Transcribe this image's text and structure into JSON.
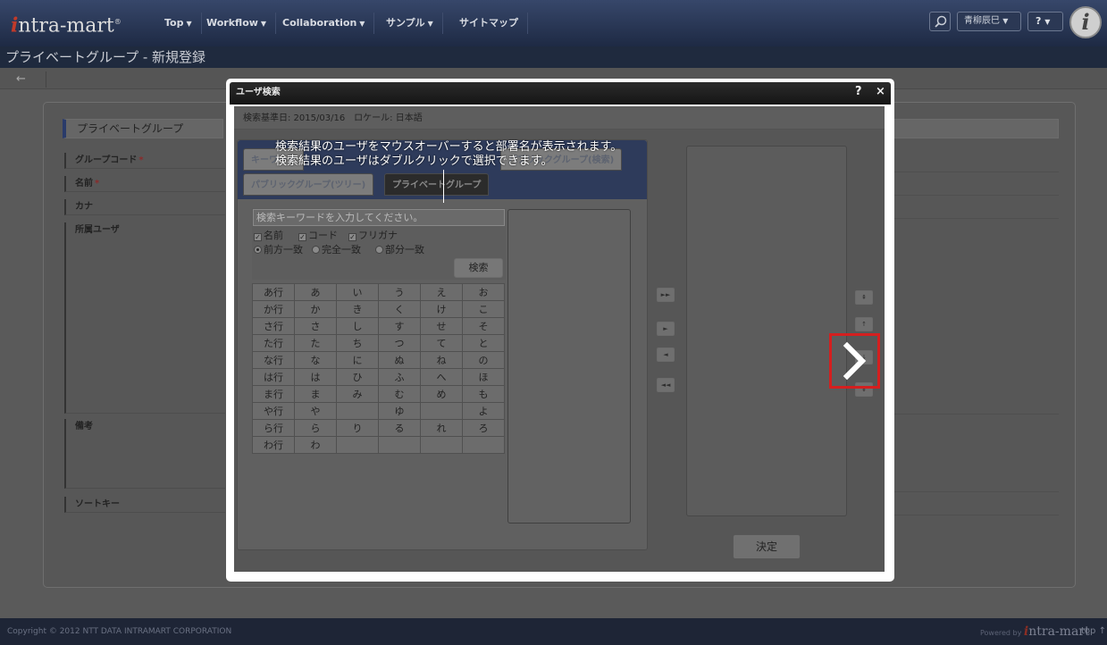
{
  "navbar": {
    "logo_prefix": "i",
    "logo_rest": "ntra-mart",
    "logo_mark": "®",
    "menus": [
      {
        "label": "Top"
      },
      {
        "label": "Workflow"
      },
      {
        "label": "Collaboration"
      },
      {
        "label": "サンプル"
      },
      {
        "label": "サイトマップ"
      }
    ],
    "search_icon": "search-icon",
    "user_name": "青柳辰巳",
    "help_label": "?"
  },
  "page": {
    "title": "プライベートグループ - 新規登録",
    "back_icon": "←"
  },
  "form": {
    "section_title": "プライベートグループ",
    "fields": [
      {
        "label": "グループコード",
        "required": "*"
      },
      {
        "label": "名前",
        "required": "*"
      },
      {
        "label": "カナ",
        "required": ""
      },
      {
        "label": "所属ユーザ",
        "required": ""
      },
      {
        "label": "備考",
        "required": ""
      },
      {
        "label": "ソートキー",
        "required": ""
      }
    ]
  },
  "modal": {
    "title": "ユーザ検索",
    "help": "?",
    "close": "×",
    "basis": "検索基準日: 2015/03/16　ロケール: 日本語",
    "tabs": [
      {
        "label": "キーワード"
      },
      {
        "label": "パブリックグループ(検索)"
      },
      {
        "label": "パブリックグループ(ツリー)"
      },
      {
        "label": "プライベートグループ"
      }
    ],
    "tip_lines": [
      "検索結果のユーザをマウスオーバーすると部署名が表示されます。",
      "検索結果のユーザはダブルクリックで選択できます。"
    ],
    "search_placeholder": "検索キーワードを入力してください。",
    "checkboxes": [
      {
        "label": "名前",
        "checked": true
      },
      {
        "label": "コード",
        "checked": true
      },
      {
        "label": "フリガナ",
        "checked": true
      }
    ],
    "radios": [
      {
        "label": "前方一致",
        "selected": true
      },
      {
        "label": "完全一致",
        "selected": false
      },
      {
        "label": "部分一致",
        "selected": false
      }
    ],
    "search_button": "検索",
    "kana_rows": [
      [
        "あ行",
        "あ",
        "い",
        "う",
        "え",
        "お"
      ],
      [
        "か行",
        "か",
        "き",
        "く",
        "け",
        "こ"
      ],
      [
        "さ行",
        "さ",
        "し",
        "す",
        "せ",
        "そ"
      ],
      [
        "た行",
        "た",
        "ち",
        "つ",
        "て",
        "と"
      ],
      [
        "な行",
        "な",
        "に",
        "ぬ",
        "ね",
        "の"
      ],
      [
        "は行",
        "は",
        "ひ",
        "ふ",
        "へ",
        "ほ"
      ],
      [
        "ま行",
        "ま",
        "み",
        "む",
        "め",
        "も"
      ],
      [
        "や行",
        "や",
        "",
        "ゆ",
        "",
        "よ"
      ],
      [
        "ら行",
        "ら",
        "り",
        "る",
        "れ",
        "ろ"
      ],
      [
        "わ行",
        "わ",
        "",
        "",
        "",
        ""
      ]
    ],
    "move_buttons": [
      "►►",
      "►",
      "◄",
      "◄◄"
    ],
    "order_buttons": [
      "⇞",
      "↑",
      "↓",
      "⇟"
    ],
    "decide_button": "決定"
  },
  "overlay": {
    "icon": "chevron-right-icon",
    "color": "#d41f1f"
  },
  "footer": {
    "copyright": "Copyright © 2012 NTT DATA INTRAMART CORPORATION",
    "powered_by": "Powered by",
    "powered_logo_prefix": "i",
    "powered_logo_rest": "ntra-mart",
    "top_link": "top ↑"
  }
}
